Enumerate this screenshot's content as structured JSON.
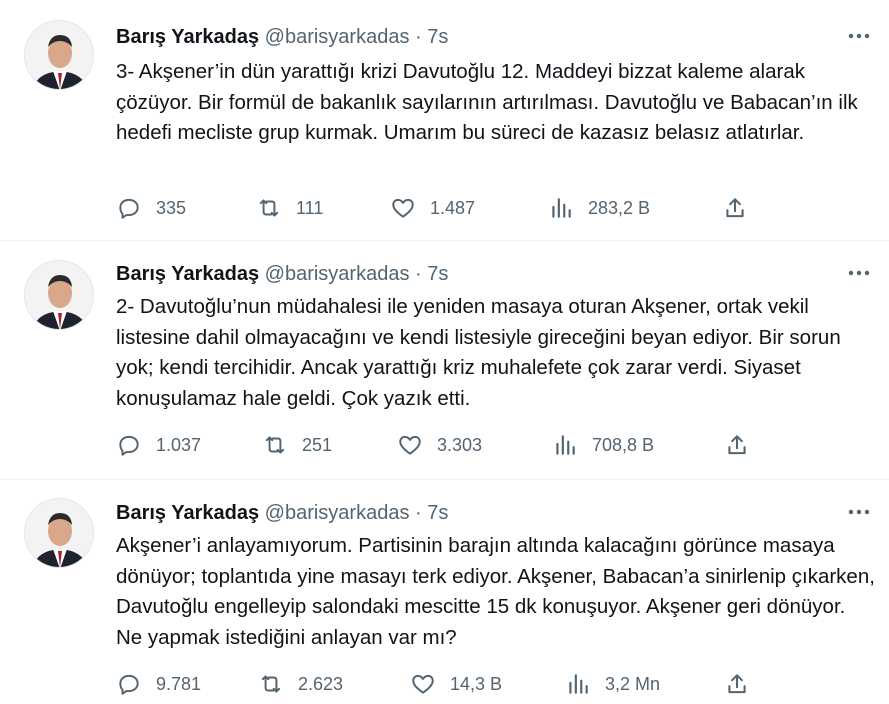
{
  "tweets": [
    {
      "author_name": "Barış Yarkadaş",
      "handle": "@barisyarkadas",
      "separator": "·",
      "time": "7s",
      "text": "3- Akşener’in dün yarattığı krizi Davutoğlu 12. Maddeyi bizzat kaleme alarak çözüyor. Bir formül de bakanlık sayılarının artırılması. Davutoğlu ve Babacan’ın ilk hedefi mecliste grup kurmak. Umarım bu süreci de kazasız belasız atlatırlar.",
      "replies": "335",
      "retweets": "111",
      "likes": "1.487",
      "views": "283,2 B"
    },
    {
      "author_name": "Barış Yarkadaş",
      "handle": "@barisyarkadas",
      "separator": "·",
      "time": "7s",
      "text": "2- Davutoğlu’nun müdahalesi ile yeniden masaya oturan Akşener,  ortak vekil listesine dahil olmayacağını ve kendi listesiyle gireceğini beyan ediyor. Bir sorun yok; kendi tercihidir. Ancak yarattığı kriz muhalefete çok zarar verdi. Siyaset konuşulamaz hale geldi. Çok yazık etti.",
      "replies": "1.037",
      "retweets": "251",
      "likes": "3.303",
      "views": "708,8 B"
    },
    {
      "author_name": "Barış Yarkadaş",
      "handle": "@barisyarkadas",
      "separator": "·",
      "time": "7s",
      "text": "Akşener’i anlayamıyorum. Partisinin barajın altında kalacağını görünce masaya dönüyor; toplantıda yine masayı terk ediyor. Akşener, Babacan’a sinirlenip çıkarken, Davutoğlu engelleyip salondaki mescitte 15 dk konuşuyor. Akşener geri dönüyor.  Ne yapmak istediğini anlayan var mı?",
      "replies": "9.781",
      "retweets": "2.623",
      "likes": "14,3 B",
      "views": "3,2 Mn"
    }
  ],
  "icons": [
    "more-icon",
    "reply-icon",
    "retweet-icon",
    "like-icon",
    "views-icon",
    "share-icon"
  ],
  "colors": {
    "text": "#0f1419",
    "secondary": "#536471",
    "divider": "#eff3f4"
  }
}
